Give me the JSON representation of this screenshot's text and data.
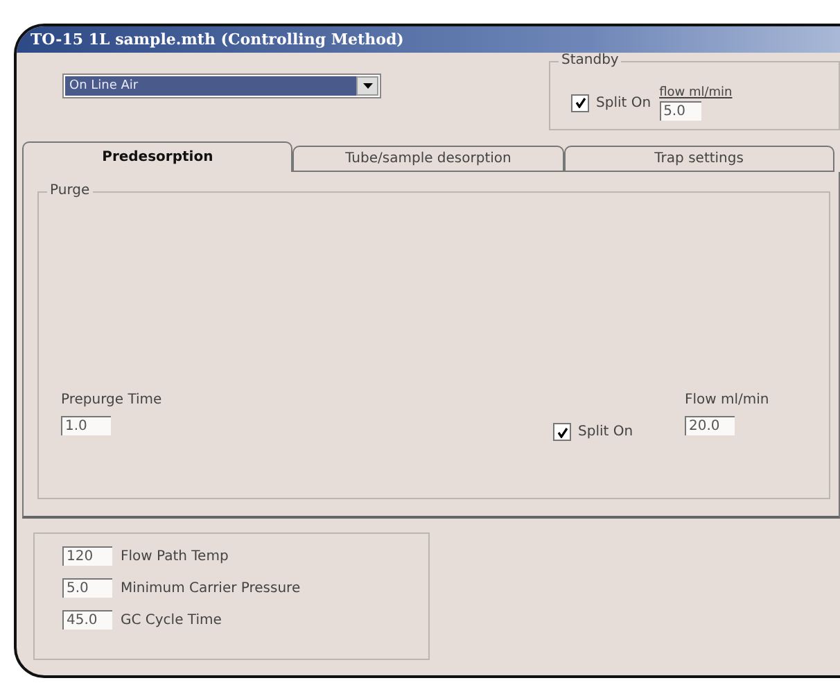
{
  "window": {
    "title": "TO-15 1L sample.mth (Controlling Method)"
  },
  "method_select": {
    "value": "On Line Air"
  },
  "standby": {
    "title": "Standby",
    "split_on": {
      "label": "Split On",
      "checked": true
    },
    "flow": {
      "label": "flow ml/min",
      "value": "5.0"
    }
  },
  "tabs": [
    {
      "label": "Predesorption",
      "selected": true
    },
    {
      "label": "Tube/sample desorption",
      "selected": false
    },
    {
      "label": "Trap settings",
      "selected": false
    }
  ],
  "purge": {
    "title": "Purge",
    "prepurge_time": {
      "label": "Prepurge Time",
      "value": "1.0"
    },
    "split_on": {
      "label": "Split On",
      "checked": true
    },
    "flow": {
      "label": "Flow ml/min",
      "value": "20.0"
    }
  },
  "settings": [
    {
      "value": "120",
      "label": "Flow Path Temp"
    },
    {
      "value": "5.0",
      "label": "Minimum Carrier Pressure"
    },
    {
      "value": "45.0",
      "label": "GC Cycle Time"
    }
  ]
}
